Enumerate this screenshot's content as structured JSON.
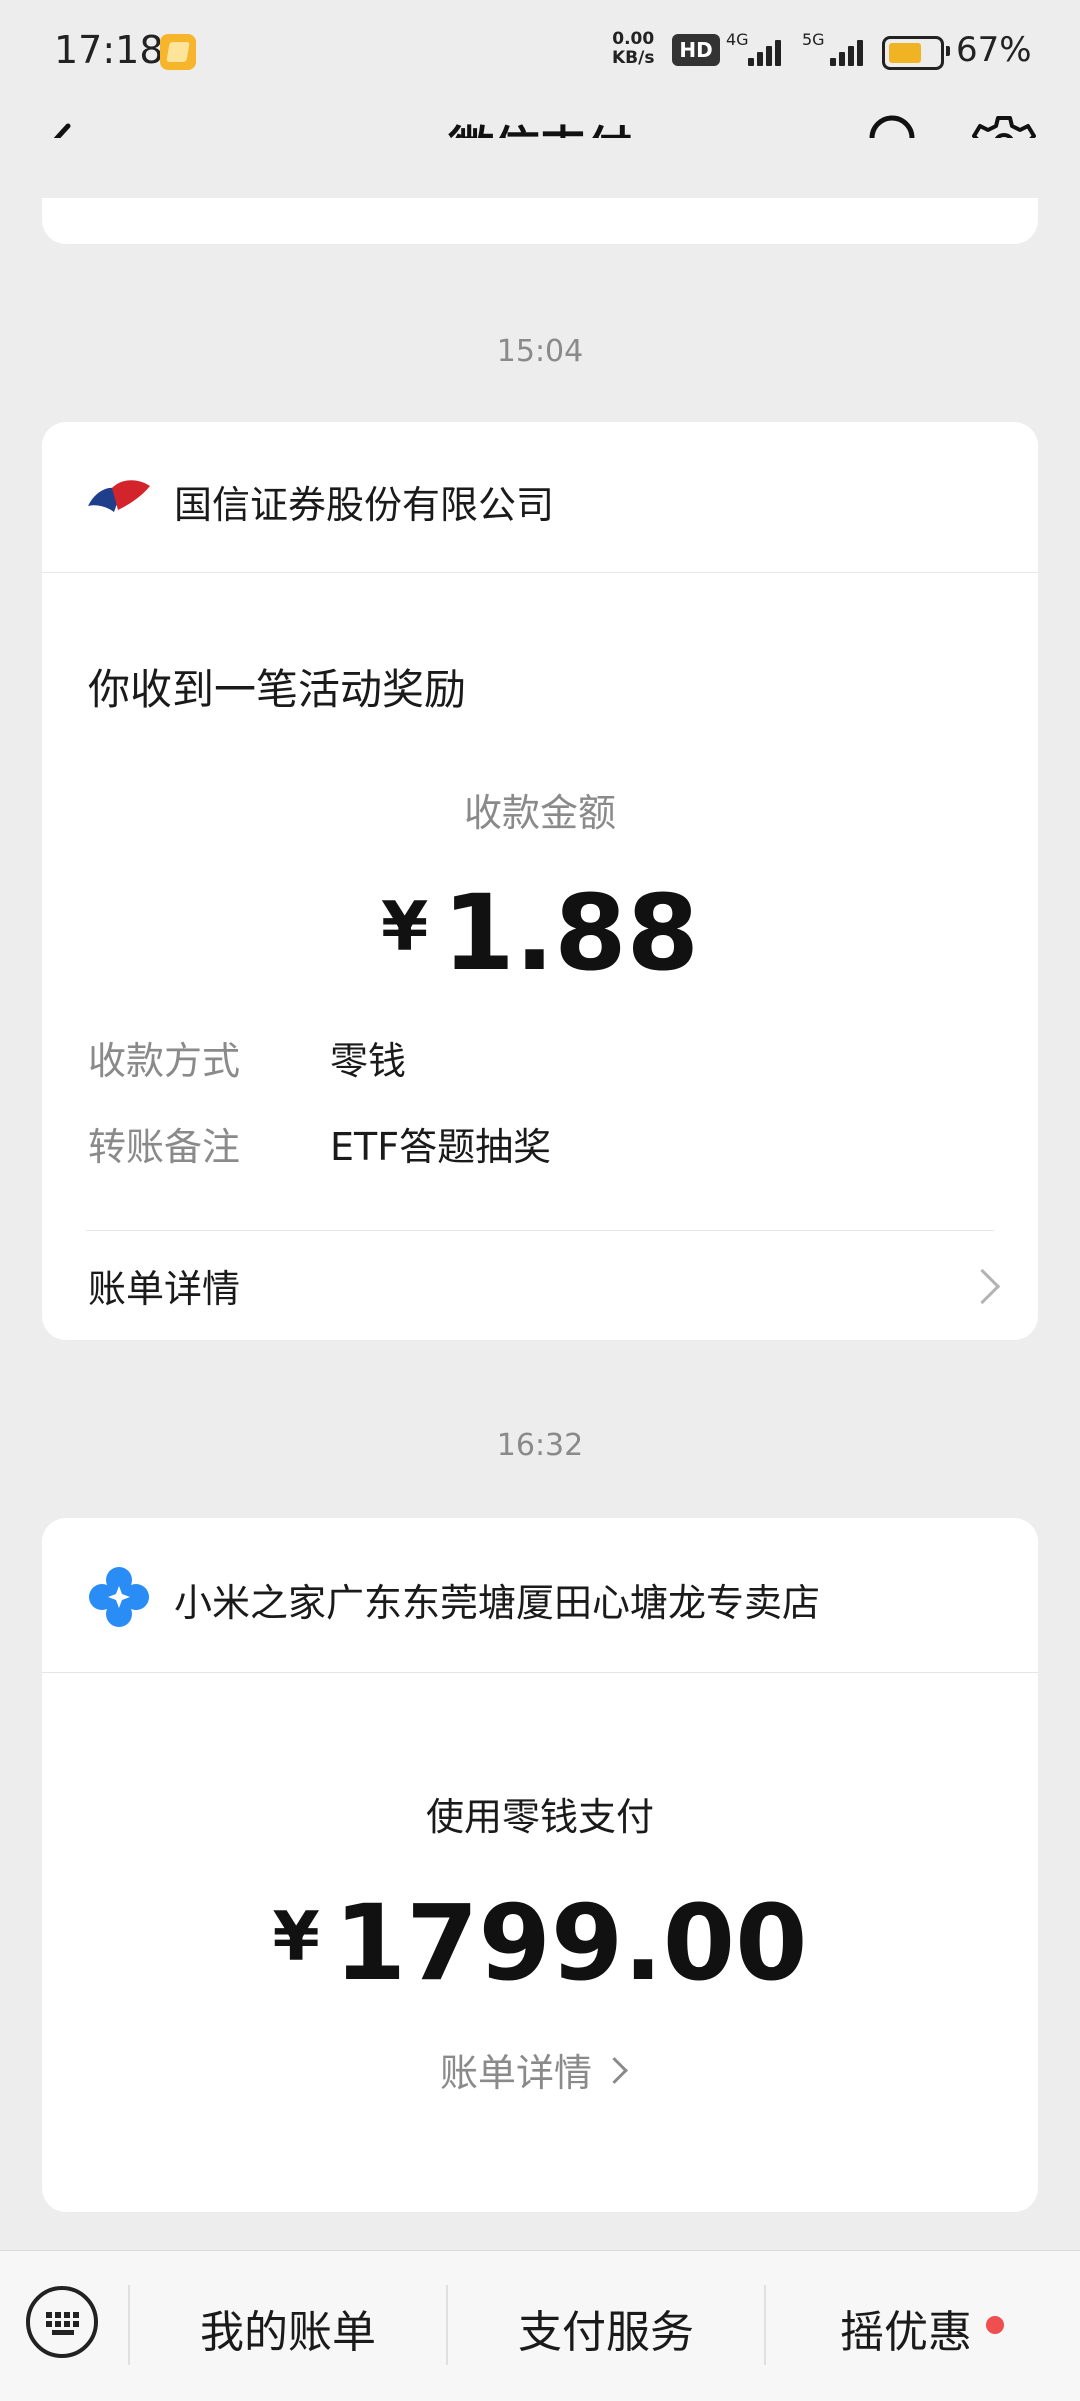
{
  "status_bar": {
    "time": "17:18",
    "net_speed_value": "0.00",
    "net_speed_unit": "KB/s",
    "hd_label": "HD",
    "network_1": "4G",
    "network_2": "5G",
    "battery_text": "67%",
    "battery_level": 0.67
  },
  "nav": {
    "title": "微信支付"
  },
  "entries": [
    {
      "time": "15:04",
      "merchant": "国信证券股份有限公司",
      "title": "你收到一笔活动奖励",
      "amount_label": "收款金额",
      "currency": "¥",
      "amount": "1.88",
      "fields": [
        {
          "label": "收款方式",
          "value": "零钱"
        },
        {
          "label": "转账备注",
          "value": "ETF答题抽奖"
        }
      ],
      "detail_link": "账单详情"
    },
    {
      "time": "16:32",
      "merchant": "小米之家广东东莞塘厦田心塘龙专卖店",
      "payment_method": "使用零钱支付",
      "currency": "¥",
      "amount": "1799.00",
      "detail_link": "账单详情"
    }
  ],
  "bottom_bar": {
    "items": [
      "我的账单",
      "支付服务",
      "摇优惠"
    ]
  },
  "colors": {
    "background": "#ededed",
    "card": "#ffffff",
    "muted_text": "#8a8a8a",
    "badge_dot": "#f04f4f",
    "battery_fill": "#f0b323"
  }
}
